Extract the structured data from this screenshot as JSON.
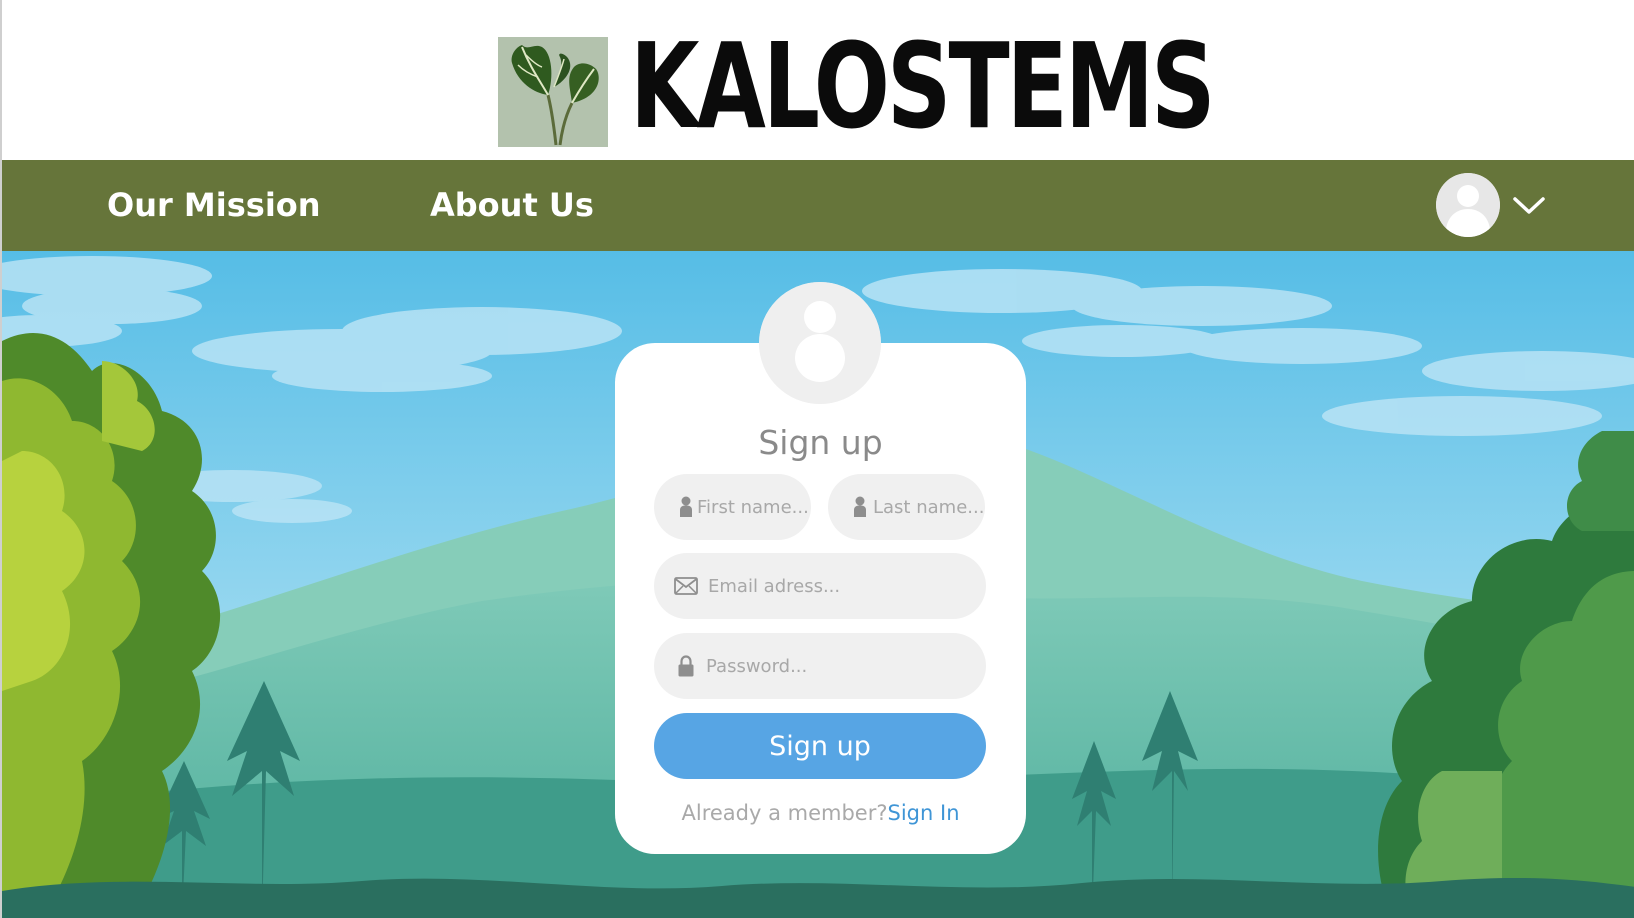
{
  "brand": {
    "name": "KALOSTEMS",
    "logo_icon": "plant-leaves-icon"
  },
  "nav": {
    "items": [
      {
        "label": "Our Mission"
      },
      {
        "label": "About Us"
      }
    ],
    "avatar_icon": "user-avatar-icon",
    "menu_icon": "chevron-down-icon",
    "background_color": "#66753a"
  },
  "signup": {
    "title": "Sign up",
    "first_name_placeholder": "First name...",
    "last_name_placeholder": "Last name...",
    "email_placeholder": "Email adress...",
    "password_placeholder": "Password...",
    "submit_label": "Sign up",
    "member_prompt": "Already a member?",
    "signin_label": "Sign In",
    "button_color": "#57a5e4",
    "link_color": "#3f95d6"
  }
}
